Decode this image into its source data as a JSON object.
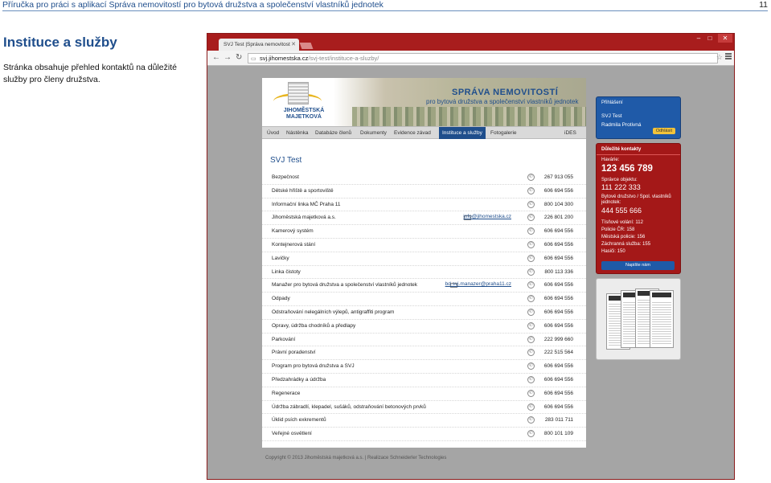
{
  "doc": {
    "header_title": "Příručka pro práci s aplikací Správa nemovitostí pro bytová družstva a společenství vlastníků jednotek",
    "page_number": "11",
    "section_title": "Instituce a služby",
    "section_text": "Stránka obsahuje přehled kontaktů na důležité služby pro členy družstva."
  },
  "browser": {
    "tab_title": "SVJ Test |Správa nemovitost",
    "url_host": "svj.jihomestska.cz",
    "url_path": "/svj-test/instituce-a-sluzby/"
  },
  "site": {
    "banner_title": "SPRÁVA NEMOVITOSTÍ",
    "banner_subtitle": "pro bytová družstva a společenství vlastníků jednotek",
    "logo_text": "JIHOMĚSTSKÁ MAJETKOVÁ",
    "nav": [
      "Úvod",
      "Nástěnka",
      "Databáze členů",
      "Dokumenty",
      "Evidence závad",
      "Instituce a služby",
      "Fotogalerie",
      "iDES"
    ],
    "nav_active_index": 5,
    "page_subtitle": "SVJ Test",
    "contacts": [
      {
        "name": "Bezpečnost",
        "email": "",
        "phone": "267 913 055"
      },
      {
        "name": "Dětské hřiště a sportoviště",
        "email": "",
        "phone": "606 694 556"
      },
      {
        "name": "Informační linka MČ Praha 11",
        "email": "",
        "phone": "800 104 300"
      },
      {
        "name": "Jihoměstská majetková a.s.",
        "email": "info@jihomestska.cz",
        "phone": "226 801 200"
      },
      {
        "name": "Kamerový systém",
        "email": "",
        "phone": "606 694 556"
      },
      {
        "name": "Kontejnerová stání",
        "email": "",
        "phone": "606 694 556"
      },
      {
        "name": "Lavičky",
        "email": "",
        "phone": "606 694 556"
      },
      {
        "name": "Linka čistoty",
        "email": "",
        "phone": "800 113 336"
      },
      {
        "name": "Manažer pro bytová družstva a společenství vlastníků jednotek",
        "email": "bd.svj.manazer@praha11.cz",
        "phone": "606 694 556"
      },
      {
        "name": "Odpady",
        "email": "",
        "phone": "606 694 556"
      },
      {
        "name": "Odstraňování nelegálních výlepů, antigraffiti program",
        "email": "",
        "phone": "606 694 556"
      },
      {
        "name": "Opravy, údržba chodníků a předlapy",
        "email": "",
        "phone": "606 694 556"
      },
      {
        "name": "Parkování",
        "email": "",
        "phone": "222 999 660"
      },
      {
        "name": "Právní poradenství",
        "email": "",
        "phone": "222 515 564"
      },
      {
        "name": "Program pro bytová družstva a SVJ",
        "email": "",
        "phone": "606 694 556"
      },
      {
        "name": "Předzahrádky a údržba",
        "email": "",
        "phone": "606 694 556"
      },
      {
        "name": "Regenerace",
        "email": "",
        "phone": "606 694 556"
      },
      {
        "name": "Údržba zábradlí, klepadel, sušáků, odstraňování betonových prvků",
        "email": "",
        "phone": "606 694 556"
      },
      {
        "name": "Úklid psích exkrementů",
        "email": "",
        "phone": "283 011 711"
      },
      {
        "name": "Veřejné osvětlení",
        "email": "",
        "phone": "800 101 109"
      }
    ],
    "footer": "Copyright © 2013 Jihoměstská majetková a.s.  |  Realizace Schneiderler Technologies"
  },
  "sidebar": {
    "login_head": "Přihlášení",
    "login_user": "SVJ Test",
    "login_name": "Radmila Protivná",
    "logout": "Odhlásit",
    "important_head": "Důležité kontakty",
    "havarie_label": "Havárie:",
    "havarie_phone": "123 456 789",
    "spravce_label": "Správce objektu:",
    "spravce_phone": "111 222 333",
    "bd_label": "Bytové družstvo / Spol. vlastníků jednotek:",
    "bd_phone": "444 555 666",
    "emergency": [
      "Tísňové volání: 112",
      "Policie ČR: 158",
      "Městská policie: 156",
      "Záchranná služba: 155",
      "Hasiči: 150"
    ],
    "write_us": "Napište nám"
  }
}
